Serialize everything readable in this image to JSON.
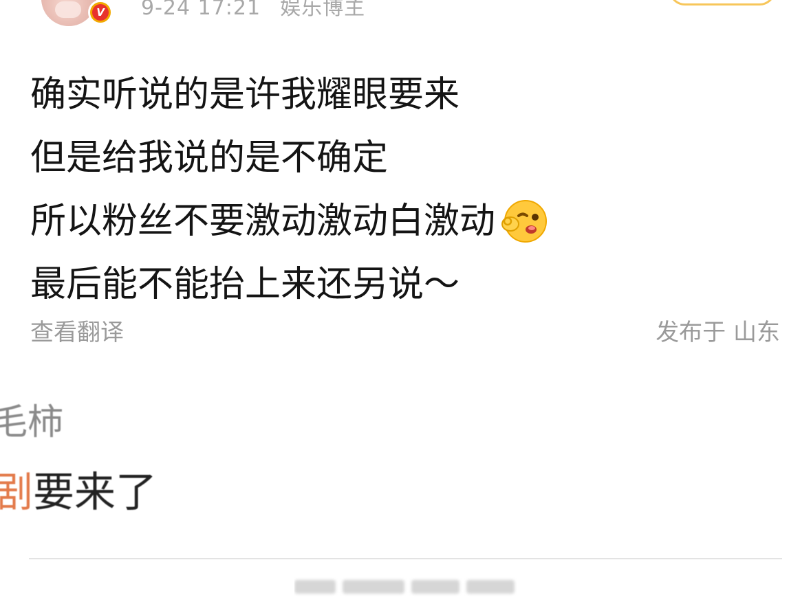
{
  "header": {
    "badge_letter": "V",
    "timestamp": "9-24 17:21",
    "source": "娱乐博主"
  },
  "post": {
    "lines": [
      "确实听说的是许我耀眼要来",
      "但是给我说的是不确定",
      "所以粉丝不要激动激动白激动",
      "最后能不能抬上来还另说～"
    ],
    "emoji": "wink-ok-emoji",
    "translate_label": "查看翻译",
    "location_label": "发布于 山东"
  },
  "comment": {
    "user": "毛柿",
    "topic": "剧",
    "text": "要来了"
  },
  "colors": {
    "meta_gray": "#a8a8a8",
    "topic_orange": "#e37a4a",
    "badge_red": "#e8322d",
    "badge_ring": "#f2a900",
    "follow_border": "#f7c65a"
  }
}
